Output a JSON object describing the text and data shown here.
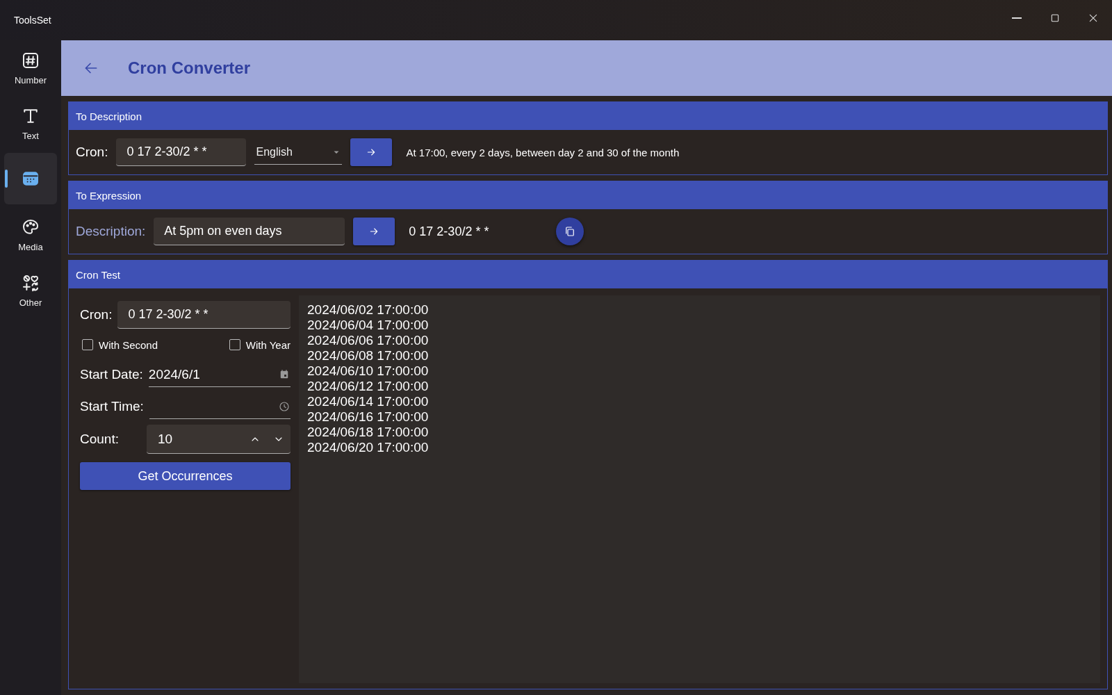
{
  "window": {
    "title": "ToolsSet"
  },
  "sidebar": {
    "items": [
      {
        "label": "Number",
        "selected": false
      },
      {
        "label": "Text",
        "selected": false
      },
      {
        "selected": true
      },
      {
        "label": "Media",
        "selected": false
      },
      {
        "label": "Other",
        "selected": false
      }
    ]
  },
  "header": {
    "title": "Cron Converter"
  },
  "to_description": {
    "title": "To Description",
    "cron_label": "Cron:",
    "cron_value": "0 17 2-30/2 * *",
    "language": "English",
    "result": "At 17:00, every 2 days, between day 2 and 30 of the month"
  },
  "to_expression": {
    "title": "To Expression",
    "description_label": "Description:",
    "description_value": "At 5pm on even days",
    "result": "0 17 2-30/2 * *"
  },
  "cron_test": {
    "title": "Cron Test",
    "cron_label": "Cron:",
    "cron_value": "0 17 2-30/2 * *",
    "checkboxes": [
      {
        "label": "With Second",
        "checked": false
      },
      {
        "label": "With Year",
        "checked": false
      }
    ],
    "start_date_label": "Start Date:",
    "start_date_value": "2024/6/1",
    "start_time_label": "Start Time:",
    "count_label": "Count:",
    "count_value": "10",
    "button": "Get Occurrences",
    "occurrences": [
      "2024/06/02 17:00:00",
      "2024/06/04 17:00:00",
      "2024/06/06 17:00:00",
      "2024/06/08 17:00:00",
      "2024/06/10 17:00:00",
      "2024/06/12 17:00:00",
      "2024/06/14 17:00:00",
      "2024/06/16 17:00:00",
      "2024/06/18 17:00:00",
      "2024/06/20 17:00:00"
    ]
  }
}
